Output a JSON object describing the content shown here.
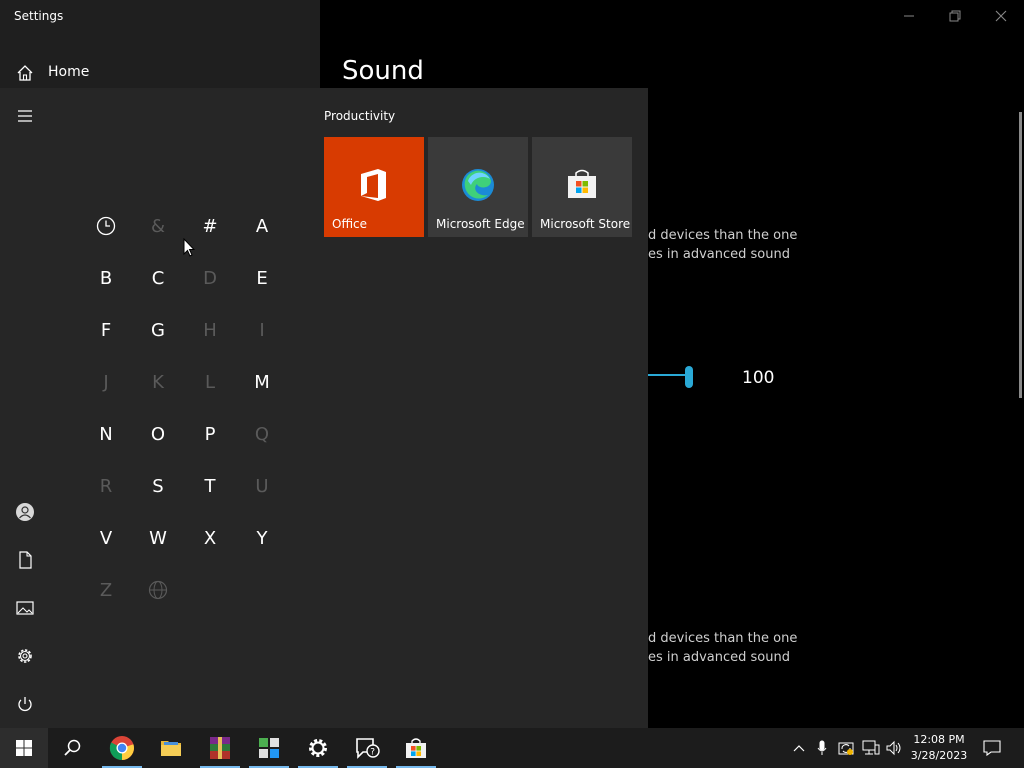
{
  "window": {
    "title": "Settings",
    "minimize": "minimize",
    "maximize": "restore",
    "close": "close"
  },
  "settings": {
    "home_label": "Home",
    "page_heading": "Sound",
    "text_top_line1": "d devices than the one",
    "text_top_line2": "es in advanced sound",
    "volume_value": "100",
    "volume_level": 100,
    "text_bottom_line1": "d devices than the one",
    "text_bottom_line2": "es in advanced sound"
  },
  "start_menu": {
    "rail": [
      {
        "name": "hamburger-menu-icon"
      },
      {
        "name": "user-account-icon"
      },
      {
        "name": "documents-icon"
      },
      {
        "name": "pictures-icon"
      },
      {
        "name": "settings-gear-icon"
      },
      {
        "name": "power-icon"
      }
    ],
    "letters": [
      {
        "label": "",
        "enabled": true,
        "icon": "clock-icon"
      },
      {
        "label": "&",
        "enabled": false
      },
      {
        "label": "#",
        "enabled": true
      },
      {
        "label": "A",
        "enabled": true
      },
      {
        "label": "B",
        "enabled": true
      },
      {
        "label": "C",
        "enabled": true
      },
      {
        "label": "D",
        "enabled": false
      },
      {
        "label": "E",
        "enabled": true
      },
      {
        "label": "F",
        "enabled": true
      },
      {
        "label": "G",
        "enabled": true
      },
      {
        "label": "H",
        "enabled": false
      },
      {
        "label": "I",
        "enabled": false
      },
      {
        "label": "J",
        "enabled": false
      },
      {
        "label": "K",
        "enabled": false
      },
      {
        "label": "L",
        "enabled": false
      },
      {
        "label": "M",
        "enabled": true
      },
      {
        "label": "N",
        "enabled": true
      },
      {
        "label": "O",
        "enabled": true
      },
      {
        "label": "P",
        "enabled": true
      },
      {
        "label": "Q",
        "enabled": false
      },
      {
        "label": "R",
        "enabled": false
      },
      {
        "label": "S",
        "enabled": true
      },
      {
        "label": "T",
        "enabled": true
      },
      {
        "label": "U",
        "enabled": false
      },
      {
        "label": "V",
        "enabled": true
      },
      {
        "label": "W",
        "enabled": true
      },
      {
        "label": "X",
        "enabled": true
      },
      {
        "label": "Y",
        "enabled": true
      },
      {
        "label": "Z",
        "enabled": false
      },
      {
        "label": "",
        "enabled": false,
        "icon": "globe-icon"
      }
    ],
    "group_title": "Productivity",
    "tiles": [
      {
        "label": "Office",
        "color": "#d83b01",
        "icon": "office-icon"
      },
      {
        "label": "Microsoft Edge",
        "color": "#3a3a3a",
        "icon": "edge-icon"
      },
      {
        "label": "Microsoft Store",
        "color": "#3a3a3a",
        "icon": "store-icon"
      }
    ]
  },
  "taskbar": {
    "apps": [
      {
        "name": "start-button",
        "icon": "windows-logo-icon"
      },
      {
        "name": "search-button",
        "icon": "search-icon"
      },
      {
        "name": "chrome-button",
        "icon": "chrome-icon"
      },
      {
        "name": "file-explorer-button",
        "icon": "folder-icon"
      },
      {
        "name": "winrar-button",
        "icon": "winrar-icon"
      },
      {
        "name": "app-grid-button",
        "icon": "app-grid-icon"
      },
      {
        "name": "settings-taskbar-button",
        "icon": "gear-icon"
      },
      {
        "name": "feedback-hub-button",
        "icon": "feedback-icon"
      },
      {
        "name": "store-taskbar-button",
        "icon": "store-icon"
      }
    ],
    "clock_time": "12:08 PM",
    "clock_date": "3/28/2023"
  },
  "colors": {
    "accent": "#2aa9d6",
    "office_tile": "#d83b01",
    "taskbar_underline": "#76b9ed"
  }
}
